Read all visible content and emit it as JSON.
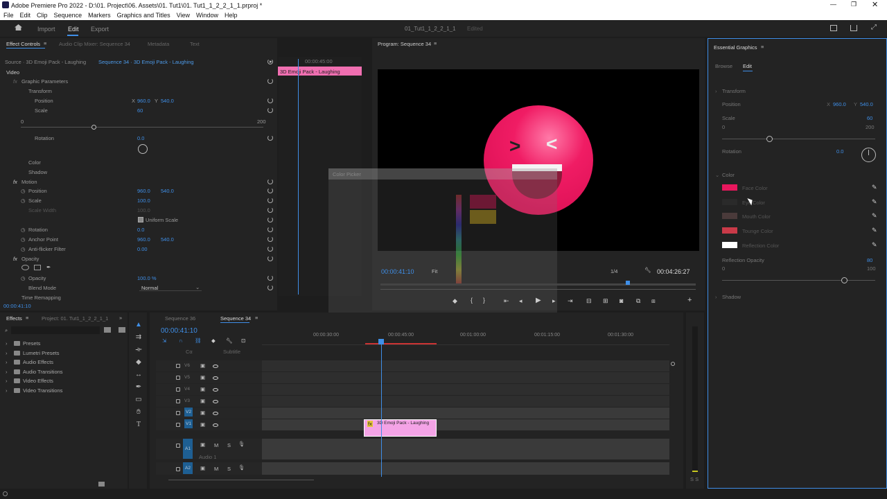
{
  "app": {
    "title": "Adobe Premiere Pro 2022 - D:\\01. Project\\06. Assets\\01. Tut1\\01. Tut1_1_2_2_1_1.prproj *"
  },
  "menu": [
    "File",
    "Edit",
    "Clip",
    "Sequence",
    "Markers",
    "Graphics and Titles",
    "View",
    "Window",
    "Help"
  ],
  "workspace": {
    "tabs": [
      "Import",
      "Edit",
      "Export"
    ],
    "project": "01_Tut1_1_2_2_1_1",
    "status": "Edited"
  },
  "effect_controls": {
    "tabs": [
      "Effect Controls",
      "Audio Clip Mixer: Sequence 34",
      "Metadata",
      "Text"
    ],
    "source": "Source · 3D Emoji Pack - Laughing",
    "sequence": "Sequence 34 · 3D Emoji Pack - Laughing",
    "video": "Video",
    "graphic_params": "Graphic Parameters",
    "transform": "Transform",
    "position": "Position",
    "x": "X",
    "px": "960.0",
    "y": "Y",
    "py": "540.0",
    "scale": "Scale",
    "scale_val": "60",
    "slider_min": "0",
    "slider_max": "200",
    "rotation": "Rotation",
    "rot_val": "0.0",
    "color": "Color",
    "shadow": "Shadow",
    "motion": "Motion",
    "m_position": "Position",
    "m_px": "960.0",
    "m_py": "540.0",
    "m_scale": "Scale",
    "m_scale_val": "100.0",
    "m_scale_width": "Scale Width",
    "m_sw_val": "100.0",
    "uniform": "Uniform Scale",
    "m_rotation": "Rotation",
    "m_rot_val": "0.0",
    "anchor": "Anchor Point",
    "ax": "960.0",
    "ay": "540.0",
    "antiflicker": "Anti-flicker Filter",
    "af_val": "0.00",
    "opacity": "Opacity",
    "op_label": "Opacity",
    "op_val": "100.0 %",
    "blend": "Blend Mode",
    "blend_val": "Normal",
    "time_remap": "Time Remapping",
    "timecode": "00:00:41:10",
    "mini_time": "00:00:45:00",
    "mini_clip": "3D Emoji Pack - Laughing"
  },
  "program": {
    "title": "Program: Sequence 34",
    "timecode": "00:00:41:10",
    "fit": "Fit",
    "quality": "1/4",
    "duration": "00:04:26:27",
    "color_picker": "Color Picker"
  },
  "essential": {
    "title": "Essential Graphics",
    "tabs": [
      "Browse",
      "Edit"
    ],
    "transform": "Transform",
    "position": "Position",
    "x": "X",
    "px": "960.0",
    "y": "Y",
    "py": "540.0",
    "scale": "Scale",
    "scale_val": "60",
    "min": "0",
    "max": "200",
    "rotation": "Rotation",
    "rot_val": "0.0",
    "color": "Color",
    "colors": [
      {
        "label": "Face Color",
        "hex": "#e8175d"
      },
      {
        "label": "Eye Color",
        "hex": "#2a2a2a"
      },
      {
        "label": "Mouth Color",
        "hex": "#4a3a3a"
      },
      {
        "label": "Tounge Color",
        "hex": "#c93a48"
      },
      {
        "label": "Reflection Color",
        "hex": "#ffffff"
      }
    ],
    "refl_opacity": "Reflection Opacity",
    "ro_val": "80",
    "ro_min": "0",
    "ro_max": "100",
    "shadow": "Shadow"
  },
  "effects": {
    "tabs": [
      "Effects",
      "Project: 01. Tut1_1_2_2_1_1"
    ],
    "folders": [
      "Presets",
      "Lumetri Presets",
      "Audio Effects",
      "Audio Transitions",
      "Video Effects",
      "Video Transitions"
    ]
  },
  "timeline": {
    "tabs": [
      "Sequence 36",
      "Sequence 34"
    ],
    "timecode": "00:00:41:10",
    "ruler": [
      "00:00:30:00",
      "00:00:45:00",
      "00:01:00:00",
      "00:01:15:00",
      "00:01:30:00"
    ],
    "subtitle": "Subtitle",
    "cc": "Cα",
    "video_tracks": [
      "V6",
      "V5",
      "V4",
      "V3",
      "V2",
      "V1"
    ],
    "audio_tracks": [
      "A1",
      "A2"
    ],
    "audio1": "Audio 1",
    "m": "M",
    "s": "S",
    "clip": "3D Emoji Pack - Laughing",
    "fx": "fx",
    "meter": "S S"
  }
}
